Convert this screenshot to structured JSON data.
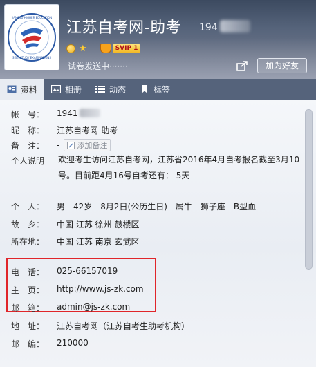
{
  "header": {
    "nickname": "江苏自考网-助考",
    "qq_number_visible": "194",
    "status_text": "试卷发送中·······",
    "vip_label": "SVIP 1",
    "add_friend_label": "加为好友",
    "avatar_text": "JIANGSU HIGHER EDUCATION SELF-STUDY EXAMINATIONS"
  },
  "tabs": [
    {
      "label": "资料",
      "icon": "profile-card-icon",
      "active": true
    },
    {
      "label": "相册",
      "icon": "photo-album-icon",
      "active": false
    },
    {
      "label": "动态",
      "icon": "feed-list-icon",
      "active": false
    },
    {
      "label": "标签",
      "icon": "bookmark-tag-icon",
      "active": false
    }
  ],
  "profile": {
    "account": {
      "label": "帐　号：",
      "value": "1941"
    },
    "nickname": {
      "label": "昵　称：",
      "value": "江苏自考网-助考"
    },
    "remark": {
      "label": "备　注：",
      "value": "-",
      "button": "添加备注"
    },
    "bio": {
      "label": "个人说明",
      "value": "欢迎考生访问江苏自考网，江苏省2016年4月自考报名截至3月10号。目前距4月16号自考还有： 5天"
    },
    "personal": {
      "label": "个　人：",
      "value": "男　42岁　8月2日(公历生日)　属牛　狮子座　B型血"
    },
    "hometown": {
      "label": "故　乡：",
      "value": "中国 江苏 徐州 鼓楼区"
    },
    "location": {
      "label": "所在地：",
      "value": "中国 江苏 南京 玄武区"
    },
    "phone": {
      "label": "电　话：",
      "value": "025-66157019"
    },
    "homepage": {
      "label": "主　页：",
      "value": "http://www.js-zk.com"
    },
    "email": {
      "label": "邮　箱：",
      "value": "admin@js-zk.com"
    },
    "address": {
      "label": "地　址：",
      "value": "江苏自考网（江苏自考生助考机构）"
    },
    "zipcode": {
      "label": "邮　编：",
      "value": "210000"
    }
  },
  "colors": {
    "header_bg": "#55637a",
    "tab_active_bg": "#e8ecf2",
    "highlight_border": "#e0252a"
  }
}
